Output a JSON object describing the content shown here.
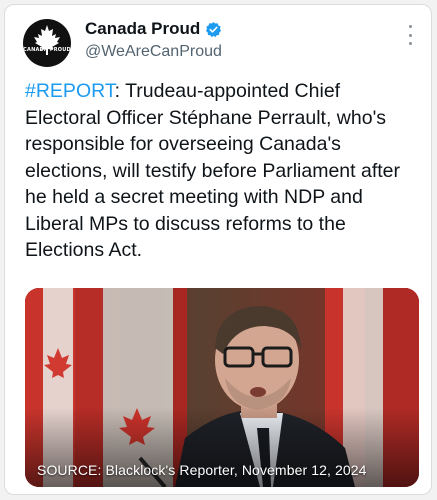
{
  "account": {
    "display_name": "Canada Proud",
    "handle": "@WeAreCanProud",
    "avatar_text": "CANADA PROUD"
  },
  "tweet": {
    "hashtag": "#REPORT",
    "text": ": Trudeau-appointed Chief Electoral Officer Stéphane Perrault, who's responsible for overseeing Canada's elections, will testify before Parliament after he held a secret meeting with NDP and Liberal MPs to discuss reforms to the Elections Act."
  },
  "media": {
    "caption": "SOURCE: Blacklock's Reporter, November 12, 2024"
  },
  "icons": {
    "verified": "verified-badge-icon",
    "more": "more-options-icon"
  },
  "colors": {
    "accent": "#1d9bf0",
    "text": "#0f1419",
    "secondary": "#536471"
  }
}
